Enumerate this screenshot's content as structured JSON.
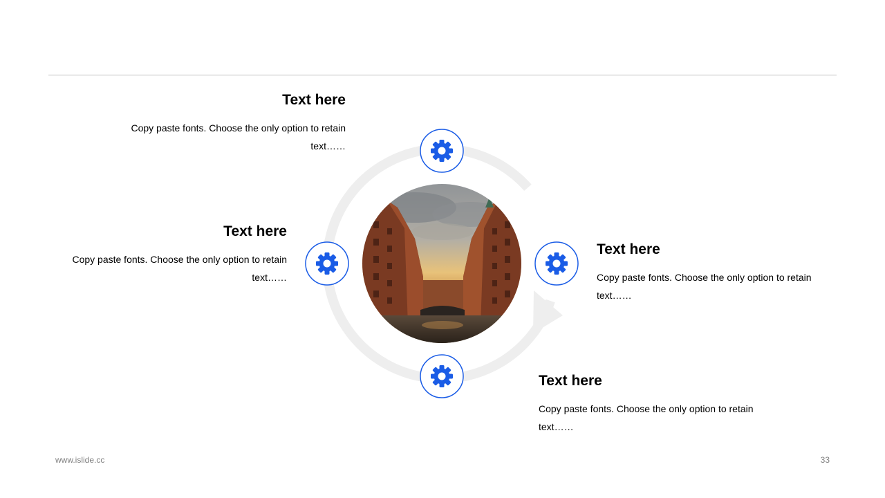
{
  "slide": {
    "accent_color": "#1a5ce6",
    "ring_color": "#eeeeee",
    "rule_color": "#bfbfbf"
  },
  "diagram": {
    "center_image": "photo-canal-warehouses",
    "nodes": [
      {
        "id": "top",
        "icon": "gear-icon",
        "title": "Text here",
        "body": "Copy paste fonts. Choose the only option to retain text……"
      },
      {
        "id": "left",
        "icon": "gear-icon",
        "title": "Text here",
        "body": "Copy paste fonts. Choose the only option to retain text……"
      },
      {
        "id": "right",
        "icon": "gear-icon",
        "title": "Text here",
        "body": "Copy paste fonts. Choose the only option to retain text……"
      },
      {
        "id": "bottom",
        "icon": "gear-icon",
        "title": "Text here",
        "body": "Copy paste fonts. Choose the only option to retain text……"
      }
    ]
  },
  "footer": {
    "url": "www.islide.cc",
    "page_number": "33"
  }
}
